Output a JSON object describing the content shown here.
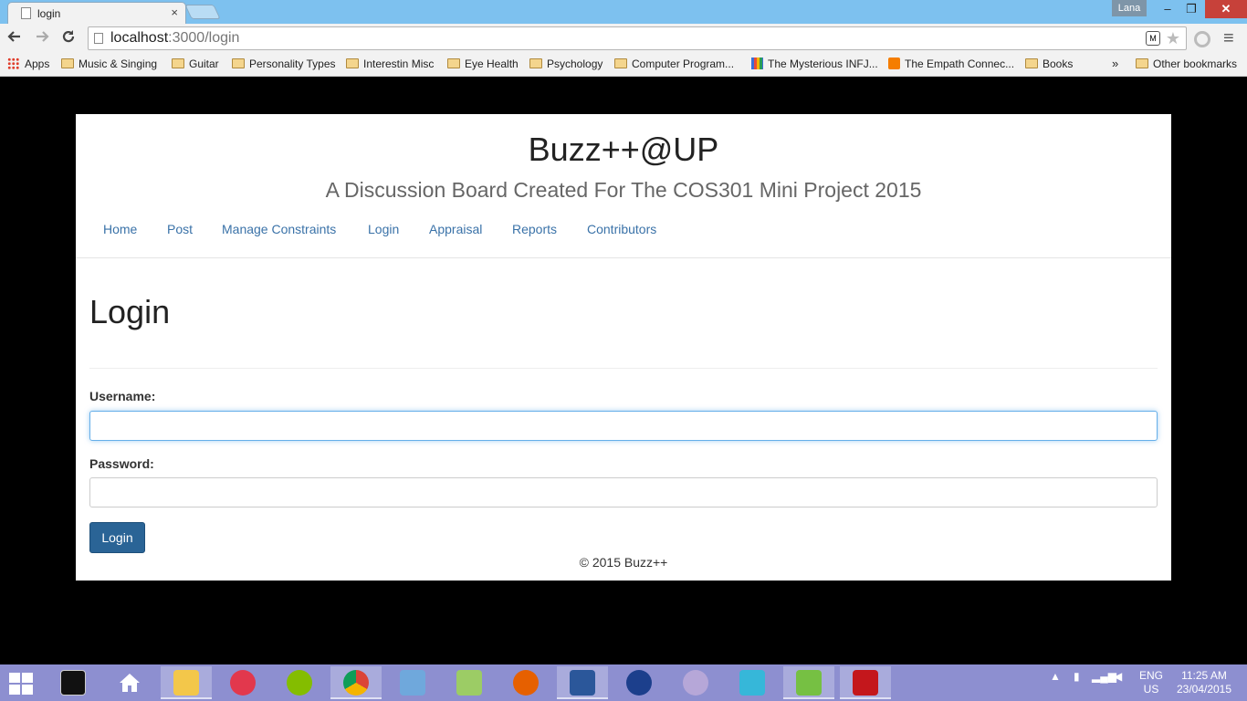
{
  "browser": {
    "tab_title": "login",
    "tab_close": "×",
    "user_badge": "Lana",
    "window_controls": {
      "minimize": "‒",
      "maximize": "❐",
      "close": "✕"
    },
    "url_host": "localhost",
    "url_path": ":3000/login",
    "menu_icon": "≡",
    "extension_icon": "M",
    "bookmarks": [
      {
        "label": "Apps",
        "icon": "apps-grid-icon"
      },
      {
        "label": "Music & Singing",
        "icon": "folder-icon"
      },
      {
        "label": "Guitar",
        "icon": "folder-icon"
      },
      {
        "label": "Personality Types",
        "icon": "folder-icon"
      },
      {
        "label": "Interestin Misc",
        "icon": "folder-icon"
      },
      {
        "label": "Eye Health",
        "icon": "folder-icon"
      },
      {
        "label": "Psychology",
        "icon": "folder-icon"
      },
      {
        "label": "Computer Program...",
        "icon": "folder-icon"
      },
      {
        "label": "The Mysterious INFJ...",
        "icon": "grid-site-icon"
      },
      {
        "label": "The Empath Connec...",
        "icon": "blogger-icon"
      },
      {
        "label": "Books",
        "icon": "folder-icon"
      }
    ],
    "bookmarks_overflow": "»",
    "other_bookmarks": "Other bookmarks"
  },
  "site": {
    "title": "Buzz++@UP",
    "subtitle": "A Discussion Board Created For The COS301 Mini Project 2015",
    "nav": [
      "Home",
      "Post",
      "Manage Constraints",
      "Login",
      "Appraisal",
      "Reports",
      "Contributors"
    ],
    "page_heading": "Login",
    "form": {
      "username_label": "Username:",
      "username_value": "",
      "password_label": "Password:",
      "password_value": "",
      "submit_label": "Login"
    },
    "footer": "© 2015 Buzz++"
  },
  "taskbar": {
    "apps": [
      "cmd",
      "home",
      "file-explorer",
      "itunes",
      "spotify",
      "chrome",
      "virtualbox",
      "notepad++",
      "firefox",
      "word",
      "audacity",
      "pidgin",
      "visual-studio",
      "node",
      "acrobat"
    ],
    "active_app": "chrome",
    "language": "ENG",
    "region": "US",
    "time": "11:25 AM",
    "date": "23/04/2015"
  },
  "colors": {
    "accent_link": "#3a72a8",
    "primary_button": "#2a6496",
    "taskbar": "#8d8fd0",
    "titlebar": "#7dc1ef"
  }
}
